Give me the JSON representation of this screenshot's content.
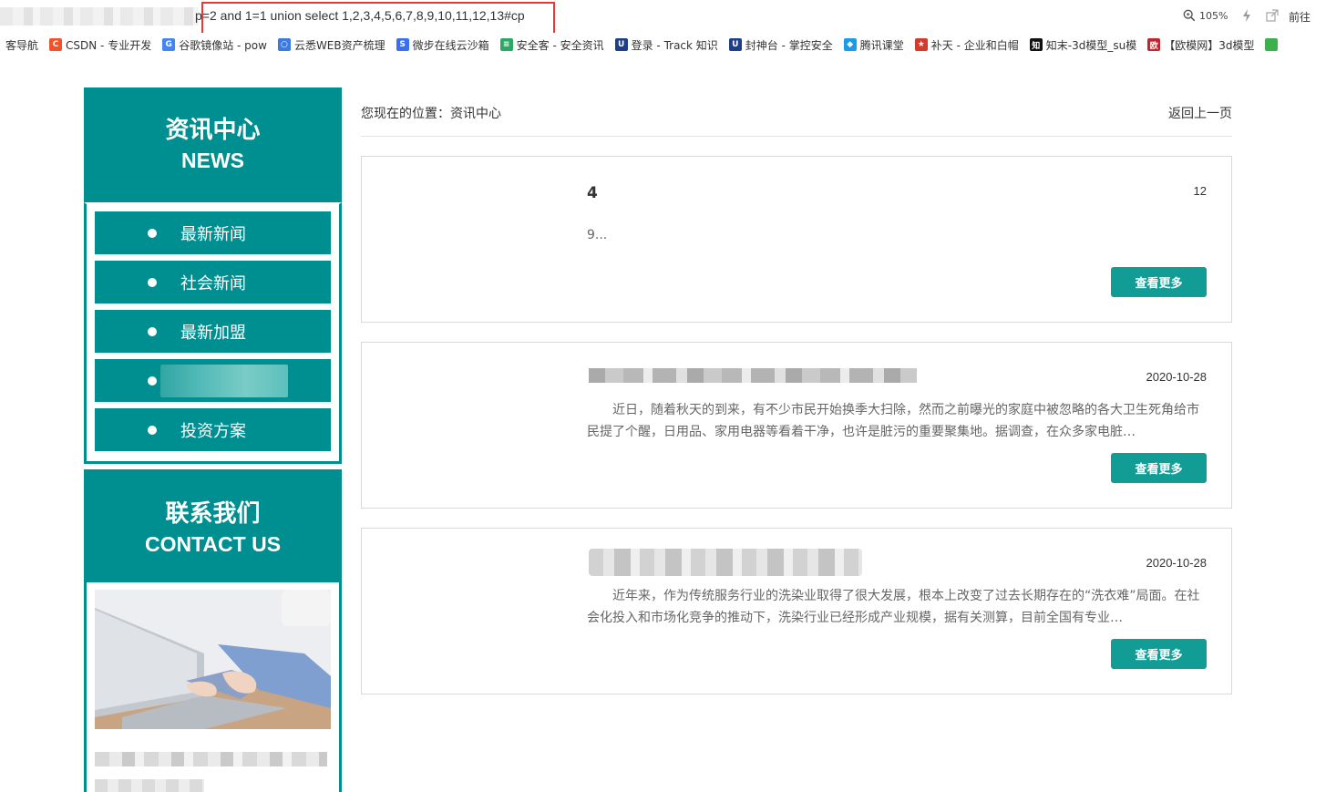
{
  "browser": {
    "url_text": "p=2 and 1=1 union select 1,2,3,4,5,6,7,8,9,10,11,12,13#cp",
    "zoom": "105%",
    "go_label": "前往",
    "bookmarks": [
      {
        "label": "客导航",
        "icon_text": "",
        "color": "#ffffff",
        "fade": ""
      },
      {
        "label": "CSDN - 专业开发",
        "icon_text": "C",
        "color": "#f0522b",
        "fade": ""
      },
      {
        "label": "谷歌镜像站 - pow",
        "icon_text": "G",
        "color": "#4285f4",
        "fade": ""
      },
      {
        "label": "云悉WEB资产梳理",
        "icon_text": "○",
        "color": "#3b7ae0",
        "fade": ""
      },
      {
        "label": "微步在线云沙箱",
        "icon_text": "S",
        "color": "#3a6ff0",
        "fade": ""
      },
      {
        "label": "安全客 - 安全资讯",
        "icon_text": "≡",
        "color": "#2aa865",
        "fade": ""
      },
      {
        "label": "登录 - Track 知识",
        "icon_text": "U",
        "color": "#1d3e8a",
        "fade": ""
      },
      {
        "label": "封神台 - 掌控安全",
        "icon_text": "U",
        "color": "#1d3e8a",
        "fade": ""
      },
      {
        "label": "腾讯课堂",
        "icon_text": "◆",
        "color": "#1c9be6",
        "fade": ""
      },
      {
        "label": "补天 - 企业和白帽",
        "icon_text": "★",
        "color": "#d33a2b",
        "fade": ""
      },
      {
        "label": "知末-3d模型_su模",
        "icon_text": "知",
        "color": "#111111",
        "fade": ""
      },
      {
        "label": "【欧模网】3d模型",
        "icon_text": "欧",
        "color": "#c0262d",
        "fade": ""
      }
    ]
  },
  "sidebar": {
    "news_title_cn": "资讯中心",
    "news_title_en": "NEWS",
    "menu": [
      {
        "label": "最新新闻"
      },
      {
        "label": "社会新闻"
      },
      {
        "label": "最新加盟"
      },
      {
        "label": ""
      },
      {
        "label": "投资方案"
      }
    ],
    "contact_title_cn": "联系我们",
    "contact_title_en": "CONTACT US"
  },
  "main": {
    "breadcrumb": "您现在的位置：资讯中心",
    "back_label": "返回上一页",
    "articles": [
      {
        "title": "4",
        "date": "12",
        "excerpt": "9...",
        "more": "查看更多"
      },
      {
        "title": "",
        "date": "2020-10-28",
        "excerpt": "近日，随着秋天的到来，有不少市民开始换季大扫除，然而之前曝光的家庭中被忽略的各大卫生死角给市民提了个醒，日用品、家用电器等看着干净，也许是脏污的重要聚集地。据调查，在众多家电脏…",
        "more": "查看更多"
      },
      {
        "title": "",
        "date": "2020-10-28",
        "excerpt": "近年来，作为传统服务行业的洗染业取得了很大发展，根本上改变了过去长期存在的“洗衣难”局面。在社会化投入和市场化竞争的推动下，洗染行业已经形成产业规模，据有关测算，目前全国有专业…",
        "more": "查看更多"
      }
    ]
  },
  "colors": {
    "teal": "#008f90",
    "button": "#119d95",
    "highlight_border": "#e03a3a"
  }
}
